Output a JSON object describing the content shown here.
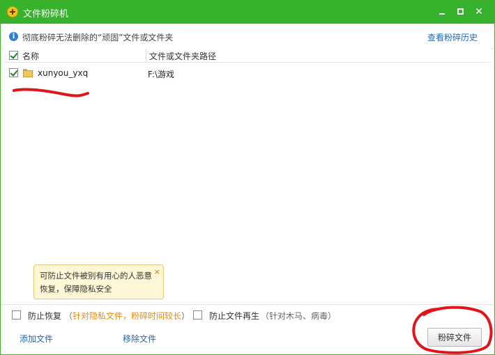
{
  "window": {
    "title": "文件粉碎机",
    "minimize_label": "—",
    "maximize_label": "□",
    "close_label": "✕"
  },
  "info": {
    "icon_glyph": "i",
    "text": "彻底粉碎无法删除的“顽固”文件或文件夹",
    "history_link": "查看粉碎历史"
  },
  "table": {
    "headers": {
      "name": "名称",
      "path": "文件或文件夹路径"
    },
    "rows": [
      {
        "name": "xunyou_yxq",
        "path": "F:\\游戏",
        "checked": true
      }
    ]
  },
  "tooltip": {
    "line1": "可防止文件被别有用心的人恶意",
    "line2": "恢复，保障隐私安全",
    "close_label": "×"
  },
  "options": {
    "prevent_restore_label": "防止恢复",
    "prevent_restore_note_open": "（",
    "prevent_restore_note": "针对隐私文件，粉碎时间较长",
    "prevent_restore_note_close": "）",
    "prevent_regen_label": "防止文件再生",
    "prevent_regen_note": "（针对木马、病毒）"
  },
  "footer": {
    "add_file": "添加文件",
    "remove_file": "移除文件",
    "shred_button": "粉碎文件"
  },
  "colors": {
    "titlebar": "#37b22c",
    "link": "#2366b8",
    "note_orange": "#e88a10",
    "annotation_red": "#e0141a"
  }
}
